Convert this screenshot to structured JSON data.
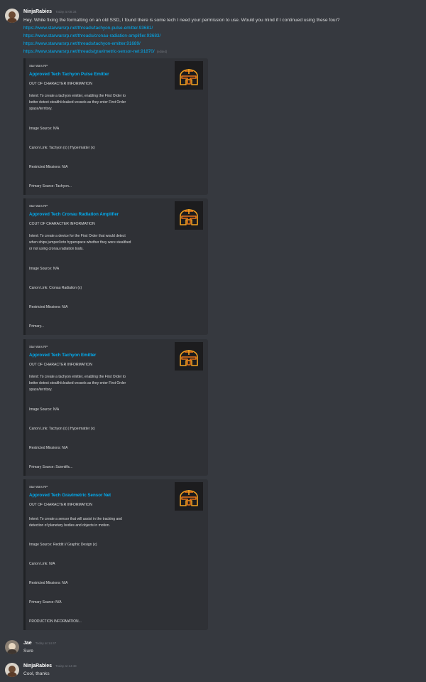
{
  "messages": {
    "m1": {
      "author": "NinjaRabies",
      "timestamp": "Today at 08:34",
      "text": "Hey. While fixing the formatting on an old SSD, I found there is some tech I need your permission to use. Would you mind if I continued using these four?",
      "links": [
        "https://www.starwarsrp.net/threads/tachyon-pulse-emitter.93681/",
        "https://www.starwarsrp.net/threads/cronau-radiation-amplifier.93683/",
        "https://www.starwarsrp.net/threads/tachyon-emitter.91689/",
        "https://www.starwarsrp.net/threads/gravimetric-sensor-net.91870/"
      ],
      "edited": "(edited)"
    },
    "m2": {
      "author": "Jae",
      "timestamp": "Today at 14:47",
      "text": "Sure"
    },
    "m3": {
      "author": "NinjaRabies",
      "timestamp": "Today at 14:48",
      "text": "Cool, thanks"
    }
  },
  "embeds": [
    {
      "provider": "Star Wars RP",
      "title": "Approved Tech Tachyon Pulse Emitter",
      "subtitle": "OUT OF CHARACTER INFORMATION",
      "desc": [
        "Intent: To create a tachyon emitter, enabling the First Order to",
        "better detect stealth/cloaked vessels as they enter First Order",
        "space/territory."
      ],
      "fields": [
        "Image Source: N/A",
        "Canon Link: Tachyon (x) | Hypermatter (x)",
        "Restricted Missions: N/A",
        "Primary Source: Tachyon..."
      ]
    },
    {
      "provider": "Star Wars RP",
      "title": "Approved Tech Cronau Radiation Amplifier",
      "subtitle": "COUT OF CHARACTER INFORMATION",
      "desc": [
        "Intent: To create a device for the First Order that would detect",
        "when ships jumped into hyperspace whether they were stealthed",
        "or not using cronau radiation trails."
      ],
      "fields": [
        "Image Source: N/A",
        "Canon Link: Cronau Radiation (x)",
        "Restricted Missions: N/A",
        "Primary..."
      ]
    },
    {
      "provider": "Star Wars RP",
      "title": "Approved Tech Tachyon Emitter",
      "subtitle": "OUT OF CHARACTER INFORMATION",
      "desc": [
        "Intent: To create a tachyon emitter, enabling the First Order to",
        "better detect stealth/cloaked vessels as they enter First Order",
        "space/territory."
      ],
      "fields": [
        "Image Source: N/A",
        "Canon Link: Tachyon (x) | Hypermatter (x)",
        "Restricted Missions: N/A",
        "Primary Source: Scientific..."
      ]
    },
    {
      "provider": "Star Wars RP",
      "title": "Approved Tech Gravimetric Sensor Net",
      "subtitle": "OUT OF CHARACTER INFORMATION",
      "desc": [
        "Intent: To create a sensor that will assist in the tracking and",
        "detection of planetary bodies and objects in motion."
      ],
      "fields": [
        "Image Source: Reddit // Graphic Design (x)",
        "Canon Link: N/A",
        "Restricted Missions: N/A",
        "Primary Source: N/A",
        "PRODUCTION INFORMATION..."
      ]
    }
  ],
  "icons": {
    "avatar": "user-avatar-icon",
    "thumbnail": "mandalorian-helmet-icon"
  },
  "colors": {
    "background": "#36393f",
    "embed": "#2f3136",
    "link": "#00aff4",
    "helmet": "#f0a020"
  }
}
